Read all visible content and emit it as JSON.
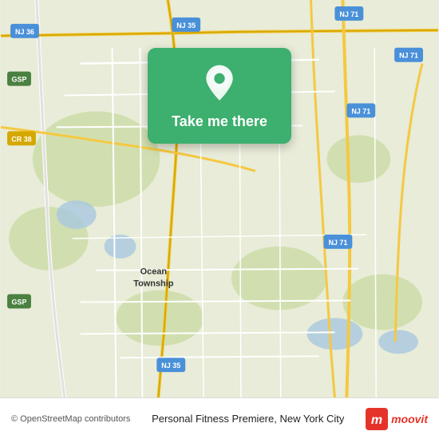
{
  "map": {
    "bg_color": "#e8ecd8",
    "action_button_label": "Take me there",
    "action_bg_color": "#3daf6e"
  },
  "bottom_bar": {
    "copyright": "© OpenStreetMap contributors",
    "location_name": "Personal Fitness Premiere, New York City",
    "moovit_label": "moovit"
  },
  "roads": {
    "labels": [
      "NJ 71",
      "NJ 35",
      "NJ 36",
      "CR 38",
      "GSP",
      "CR 38"
    ]
  }
}
